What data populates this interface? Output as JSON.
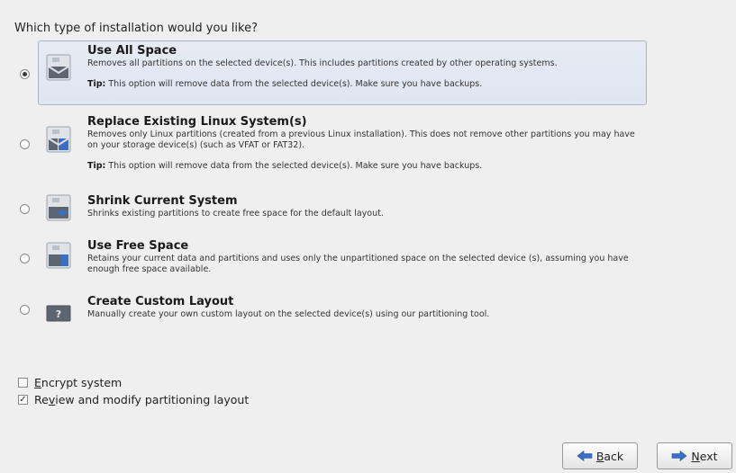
{
  "question": "Which type of installation would you like?",
  "options": [
    {
      "title": "Use All Space",
      "desc": "Removes all partitions on the selected device(s).  This includes partitions created by other operating systems.",
      "tip_label": "Tip:",
      "tip_text": " This option will remove data from the selected device(s).  Make sure you have backups.",
      "selected": true,
      "icon": "disk-full-icon"
    },
    {
      "title": "Replace Existing Linux System(s)",
      "desc": "Removes only Linux partitions (created from a previous Linux installation).  This does not remove other partitions you may have on your storage device(s) (such as VFAT or FAT32).",
      "tip_label": "Tip:",
      "tip_text": " This option will remove data from the selected device(s).  Make sure you have backups.",
      "selected": false,
      "icon": "disk-replace-icon"
    },
    {
      "title": "Shrink Current System",
      "desc": "Shrinks existing partitions to create free space for the default layout.",
      "selected": false,
      "icon": "disk-shrink-icon"
    },
    {
      "title": "Use Free Space",
      "desc": "Retains your current data and partitions and uses only the unpartitioned space on the selected device (s), assuming you have enough free space available.",
      "selected": false,
      "icon": "disk-free-icon"
    },
    {
      "title": "Create Custom Layout",
      "desc": "Manually create your own custom layout on the selected device(s) using our partitioning tool.",
      "selected": false,
      "icon": "custom-layout-icon"
    }
  ],
  "encrypt": {
    "mnemonic": "E",
    "rest": "ncrypt system",
    "checked": false
  },
  "review": {
    "before": "Re",
    "mnemonic": "v",
    "rest": "iew and modify partitioning layout",
    "checked": true
  },
  "buttons": {
    "back_mnemonic": "B",
    "back_rest": "ack",
    "next_mnemonic": "N",
    "next_rest": "ext"
  },
  "colors": {
    "selected_bg": "#e2e8f1",
    "selected_border": "#a7b6cc",
    "arrow_blue": "#3b6fc6"
  }
}
